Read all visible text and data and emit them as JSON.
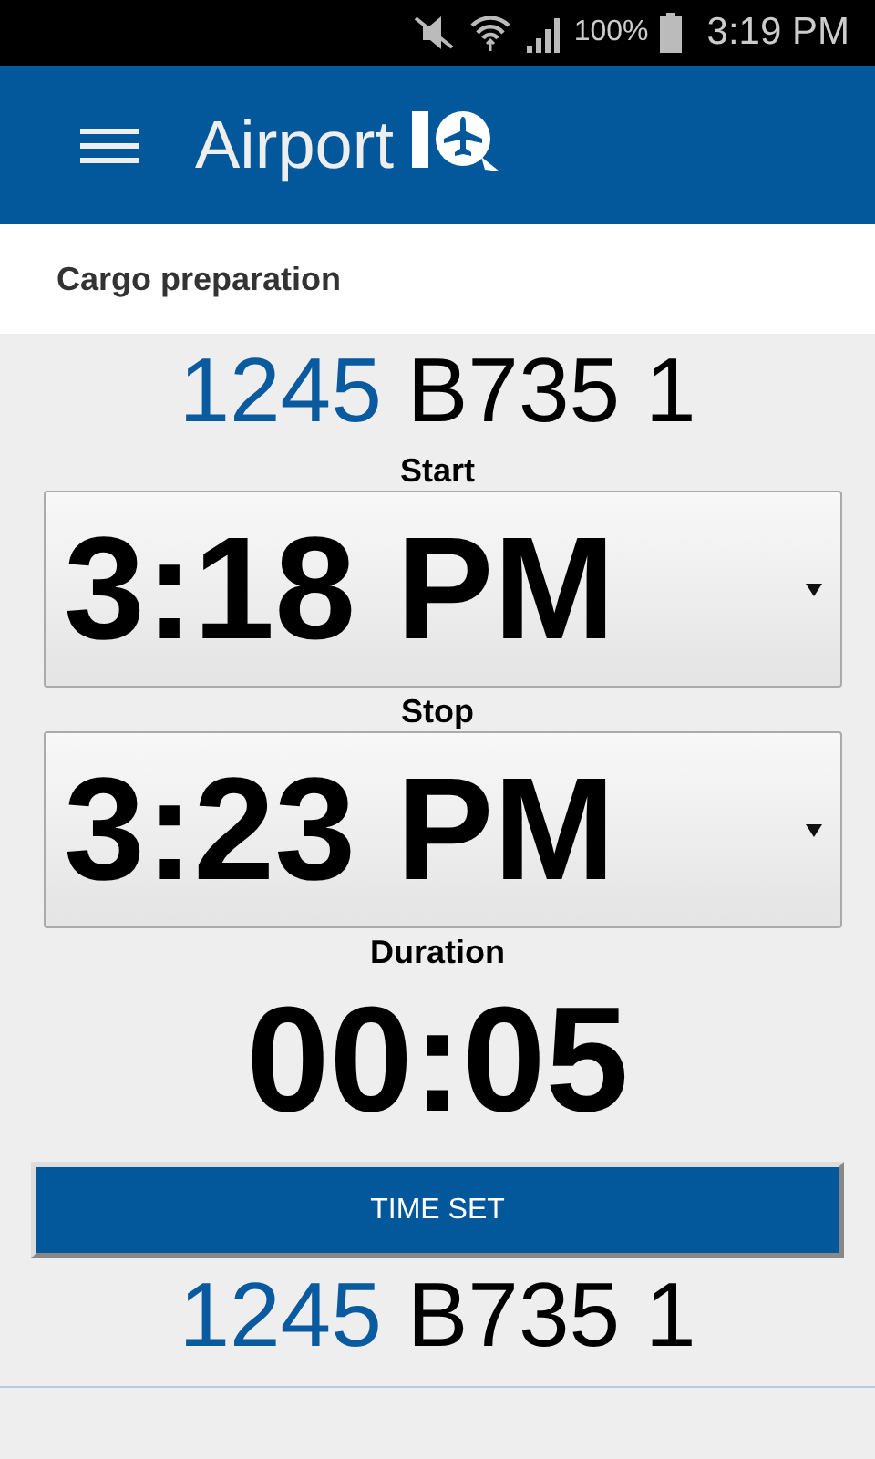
{
  "status_bar": {
    "battery": "100%",
    "time": "3:19 PM"
  },
  "app_bar": {
    "title": "Airport"
  },
  "subheader": "Cargo preparation",
  "flight_top": {
    "number": "1245",
    "aircraft": "B735 1"
  },
  "pickers": [
    {
      "label": "Start",
      "value": "3:18 PM"
    },
    {
      "label": "Stop",
      "value": "3:23 PM"
    }
  ],
  "duration": {
    "label": "Duration",
    "value": "00:05"
  },
  "button": "TIME SET",
  "flight_bottom": {
    "number": "1245",
    "aircraft": "B735 1"
  }
}
